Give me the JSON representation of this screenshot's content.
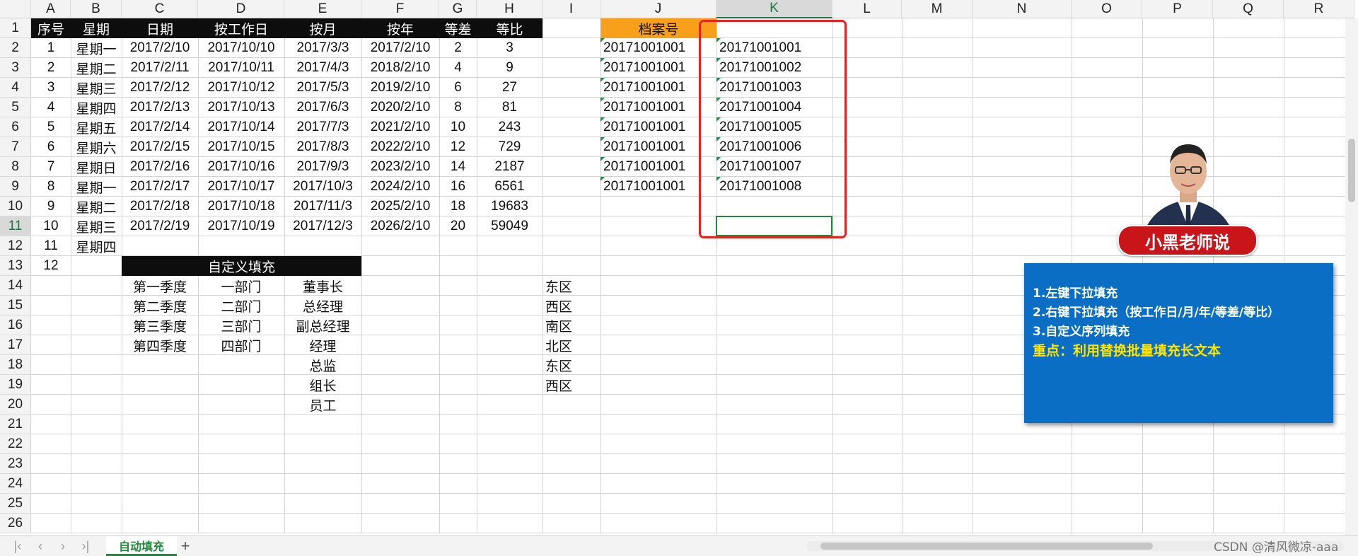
{
  "columns": [
    "A",
    "B",
    "C",
    "D",
    "E",
    "F",
    "G",
    "H",
    "I",
    "J",
    "K",
    "L",
    "M",
    "N",
    "O",
    "P",
    "Q",
    "R"
  ],
  "active_column": "K",
  "active_row": "11",
  "table_headers": [
    "序号",
    "星期",
    "日期",
    "按工作日",
    "按月",
    "按年",
    "等差",
    "等比"
  ],
  "table_rows": [
    [
      "1",
      "星期一",
      "2017/2/10",
      "2017/10/10",
      "2017/3/3",
      "2017/2/10",
      "2",
      "3"
    ],
    [
      "2",
      "星期二",
      "2017/2/11",
      "2017/10/11",
      "2017/4/3",
      "2018/2/10",
      "4",
      "9"
    ],
    [
      "3",
      "星期三",
      "2017/2/12",
      "2017/10/12",
      "2017/5/3",
      "2019/2/10",
      "6",
      "27"
    ],
    [
      "4",
      "星期四",
      "2017/2/13",
      "2017/10/13",
      "2017/6/3",
      "2020/2/10",
      "8",
      "81"
    ],
    [
      "5",
      "星期五",
      "2017/2/14",
      "2017/10/14",
      "2017/7/3",
      "2021/2/10",
      "10",
      "243"
    ],
    [
      "6",
      "星期六",
      "2017/2/15",
      "2017/10/15",
      "2017/8/3",
      "2022/2/10",
      "12",
      "729"
    ],
    [
      "7",
      "星期日",
      "2017/2/16",
      "2017/10/16",
      "2017/9/3",
      "2023/2/10",
      "14",
      "2187"
    ],
    [
      "8",
      "星期一",
      "2017/2/17",
      "2017/10/17",
      "2017/10/3",
      "2024/2/10",
      "16",
      "6561"
    ],
    [
      "9",
      "星期二",
      "2017/2/18",
      "2017/10/18",
      "2017/11/3",
      "2025/2/10",
      "18",
      "19683"
    ],
    [
      "10",
      "星期三",
      "2017/2/19",
      "2017/10/19",
      "2017/12/3",
      "2026/2/10",
      "20",
      "59049"
    ],
    [
      "11",
      "星期四",
      "",
      "",
      "",
      "",
      "",
      ""
    ],
    [
      "12",
      "",
      "",
      "",
      "",
      "",
      "",
      ""
    ]
  ],
  "custom_fill_header": "自定义填充",
  "custom_lists": {
    "quarters": [
      "第一季度",
      "第二季度",
      "第三季度",
      "第四季度"
    ],
    "departments": [
      "一部门",
      "二部门",
      "三部门",
      "四部门"
    ],
    "titles": [
      "董事长",
      "总经理",
      "副总经理",
      "经理",
      "总监",
      "组长",
      "员工"
    ],
    "regions": [
      "东区",
      "西区",
      "南区",
      "北区",
      "东区",
      "西区"
    ]
  },
  "archive_header": "档案号",
  "archive_j": [
    "20171001001",
    "20171001001",
    "20171001001",
    "20171001001",
    "20171001001",
    "20171001001",
    "20171001001",
    "20171001001"
  ],
  "archive_k": [
    "20171001001",
    "20171001002",
    "20171001003",
    "20171001004",
    "20171001005",
    "20171001006",
    "20171001007",
    "20171001008"
  ],
  "presenter_badge": "小黑老师说",
  "notes": {
    "line1": "1.左键下拉填充",
    "line2": "2.右键下拉填充（按工作日/月/年/等差/等比）",
    "line3": "3.自定义序列填充",
    "highlight": "重点：利用替换批量填充长文本"
  },
  "sheet_tab": "自动填充",
  "add_sheet": "+",
  "watermark": "CSDN @清风微凉-aaa",
  "colors": {
    "header_black": "#0d0d0d",
    "header_orange": "#f8a01c",
    "panel_blue": "#0a6fc4",
    "accent_green": "#1e8a3a",
    "red_box": "#e8231f"
  }
}
